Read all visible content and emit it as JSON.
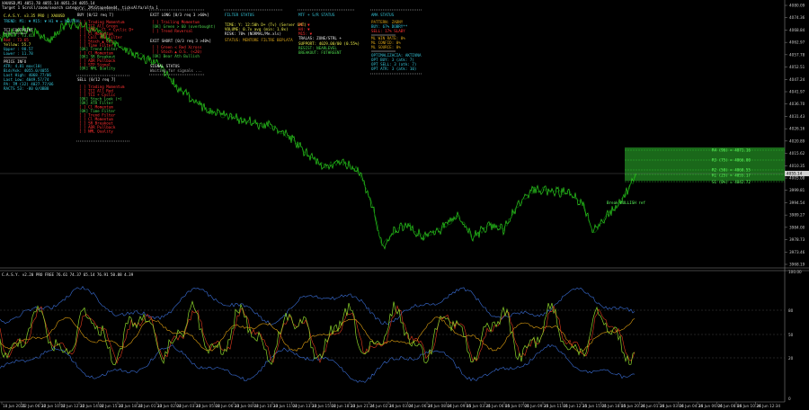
{
  "window": {
    "symbol_line": "XAUUSD,M1  4051.78 4055.14 4051.24 4055.14",
    "subtitle": "Target 1 Scroll/zoom/search category: 2MiGtape4med4, ticksAlfa/alfa 1"
  },
  "colors": {
    "background": "#000000",
    "price": "#2ecc1f",
    "price_alt": "#0a8f0a",
    "red": "#ff3030",
    "cyan": "#36c5d9",
    "gold": "#d4a017",
    "white": "#e8e8e8",
    "yellow": "#e8e84a",
    "green": "#4cd44c",
    "osc_green": "#8bd42a",
    "osc_red": "#e23b1e",
    "osc_orange": "#e0a010",
    "osc_blue": "#3a6ed6"
  },
  "panels": {
    "main_info": {
      "title": "C.A.S.Y. v3.35 PRO | XAUUSD",
      "trend": "TREND: M1: ▼ M15: ▼ H1 ▼ = NEUTRAL",
      "header2": "TCI FOOTPRINT",
      "rows": [
        "Green : 73.41",
        "Red   : 73.65",
        "Yellow: 55.7",
        "Upper : 98.57",
        "Lower : 11.78"
      ],
      "header3": "PRICE INFO",
      "price_rows": [
        "ATR:  4.81 max(10)",
        "Bid/Ask: 4055.0/4055",
        "Last High: 4068.77/06",
        "Last Low: 4049.57/74",
        "PA: 7M (32) 4027.77/06",
        "RACTS 53:  -80 0/OBB8"
      ]
    },
    "buy": {
      "title": "BUY  [0/12  req 7]",
      "items": [
        "[ ] Trading Momentum",
        "[ ] TCI All Green",
        "[ ] ITN - Cl + Cyclic D+",
        "[ ] Cl Momentum",
        "[ ] Call ATB Filter",
        "[ ] Stoch ▲ O.S.",
        "[ ] Time Filter",
        "[OK] Trend Filter",
        "[ ] Cl Momentum",
        "[OK] SR Breakout",
        "[ ] ADR Pullback",
        "[ ] STP Signal",
        "[OK] NML Quality"
      ]
    },
    "sell": {
      "title": "SELL  [0/12  req 7]",
      "items": [
        "[ ] Trading Momentum",
        "[ ] TCI All Red",
        "[ ] TCI + Cyclic",
        "[OK] Stoch Look (+)",
        "[OK] ATR Filter",
        "[ ] Cl Momentum",
        "[OK] Time Filter",
        "[ ] Trend Filter",
        "[ ] Cl Momentum",
        "[ ] SR Breakout",
        "[ ] ADR Pullback",
        "[ ] NML Quality"
      ]
    },
    "exit_long": {
      "title": "EXIT LONG  [0/3  req 3  >60%]",
      "items": [
        "[ ] Trailing Momentum",
        "[OK] Green > 60 (overbought)",
        "[ ] Trend Reversal"
      ]
    },
    "exit_short": {
      "title": "EXIT SHORT  [0/3  req 3  >40%]",
      "items": [
        "[ ] Green < Red Xcross",
        "[ ] Stoch ▲ O.S. (<20)",
        "[OK] Bear Ath Bullish"
      ]
    },
    "signal": {
      "title": "SIGNAL STATUS",
      "status": "Waiting for signals ..."
    },
    "filter": {
      "title": "FILTER STATUS",
      "rows": [
        "TIME:   Y: 12:50h  D+ (Tv)  (Server GMT)",
        "VOLUME:  0.7x avg  (min: 1.0x)",
        "RISK:   70%  (NORMAL/Me.xls)"
      ],
      "warn": "STATUS: MENTORE FILTRE BEPLATA"
    },
    "mtf": {
      "title": "MTF + S/R STATUS",
      "rows": [
        "H1:  ▼",
        "H4:  ▼",
        "M15: ▼"
      ],
      "sub": "TRALAS: ZONE/STRL +",
      "support_label": "SUPPORT: 4029.00/00 (0.55%)",
      "rows2": [
        "RESIST:  NEARLEVEL",
        "BREAKOUT: FOTHREENT"
      ]
    },
    "ama": {
      "title": "AMA STATUS",
      "rows": [
        "PATTERN: ZADNY",
        "BUY: 67%  DOBRY**",
        "SELL: 17%  SLABY"
      ],
      "ml_rows": [
        "ML WIN RATE: 0%",
        "ML CONFID:  0%",
        "ML SOURCE:  0%"
      ],
      "opt_title": "OPTIMALIZACIA: AKTIVNA",
      "opt_rows": [
        "OPT BUY:  3 (atk: 7)",
        "OPT SELL: 3 (atk: 7)",
        "OPT ATR:  3 (atk: 10)"
      ]
    }
  },
  "zone": {
    "labels": [
      "R4 (96)  = 4071.16",
      "R3 (75) = 4066.00",
      "R2 (50) = 4060.55",
      "R1 (25) = 4055.17",
      "S1 (0%) = 4042.72"
    ],
    "annotation": "Break BULLISH ref"
  },
  "price_axis": {
    "labels": [
      "4080.09",
      "4074.36",
      "4068.84",
      "4062.97",
      "4057.78",
      "4052.51",
      "4047.24",
      "4041.97",
      "4036.70",
      "4031.43",
      "4026.16",
      "4020.89",
      "4015.62",
      "4010.35",
      "4005.08",
      "3999.81",
      "3994.54",
      "3989.27",
      "3984.00",
      "3978.73",
      "3973.46",
      "3968.19"
    ],
    "current_price": "4055.14"
  },
  "oscillator": {
    "title": "C.A.S.Y. v2.20 PRO FREE 76.61  74.37  65.14  76.91  50.88  4.39",
    "levels": [
      "100.00",
      "80",
      "50",
      "20"
    ],
    "scale_label": "0"
  },
  "time_axis": {
    "labels": [
      "18 Jun 2026",
      "22 Jun 06:34",
      "22 Jun 10:54",
      "22 Jun 12:34",
      "22 Jun 14:04",
      "22 Jun 15:34",
      "22 Jun 18:34",
      "23 Jun 01:34",
      "23 Jun 02:04",
      "23 Jun 03:34",
      "23 Jun 05:04",
      "23 Jun 06:34",
      "23 Jun 08:04",
      "23 Jun 10:34",
      "23 Jun 11:04",
      "23 Jun 13:34",
      "23 Jun 15:04",
      "23 Jun 18:34",
      "23 Jun 21:34",
      "24 Jun 02:34",
      "24 Jun 03:04",
      "24 Jun 06:34",
      "24 Jun 08:04",
      "24 Jun 09:04",
      "25 Jun 03:34",
      "25 Jun 06:04",
      "25 Jun 07:04",
      "25 Jun 09:34",
      "25 Jun 11:04",
      "25 Jun 12:34",
      "25 Jun 15:04",
      "25 Jun 18:04",
      "25 Jun 20:34",
      "26 Jun 01:34",
      "26 Jun 03:04",
      "26 Jun 04:34",
      "26 Jun 06:04",
      "26 Jun 08:04",
      "26 Jun 10:34",
      "26 Jun 12:34"
    ]
  }
}
